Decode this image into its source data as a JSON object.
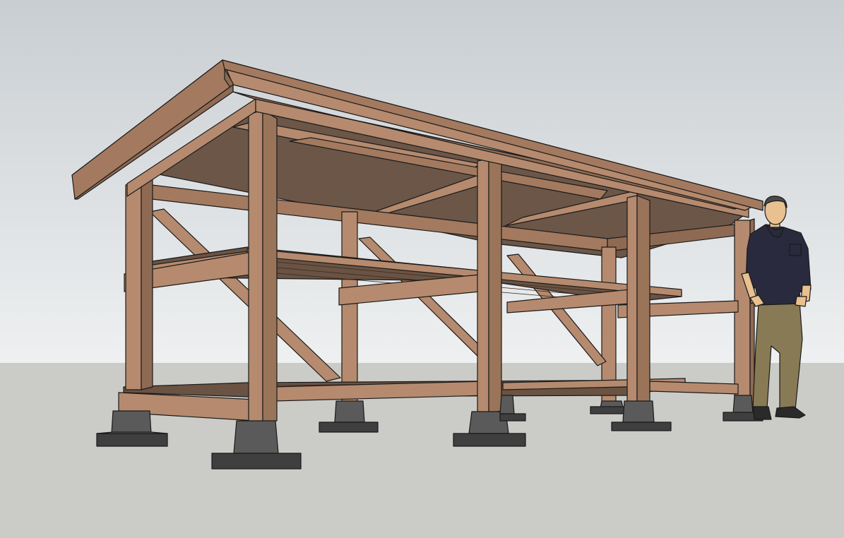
{
  "scene": {
    "subject": "wood-shed-frame-model",
    "colors": {
      "sky_top": "#c9ced2",
      "sky_bottom": "#eef0f1",
      "ground": "#cbccc7",
      "wood_light": "#b58a6e",
      "wood_mid": "#a37a5f",
      "wood_side": "#8f6a52",
      "wood_dark": "#6a5343",
      "underside": "#6b5648",
      "footing_top": "#5a5a5a",
      "footing_side": "#3f3f3f",
      "outline": "#1a1a1a",
      "shirt": "#2a2a3e",
      "pants": "#877a55",
      "skin": "#e9c08f",
      "hair": "#4a4a4a"
    }
  }
}
